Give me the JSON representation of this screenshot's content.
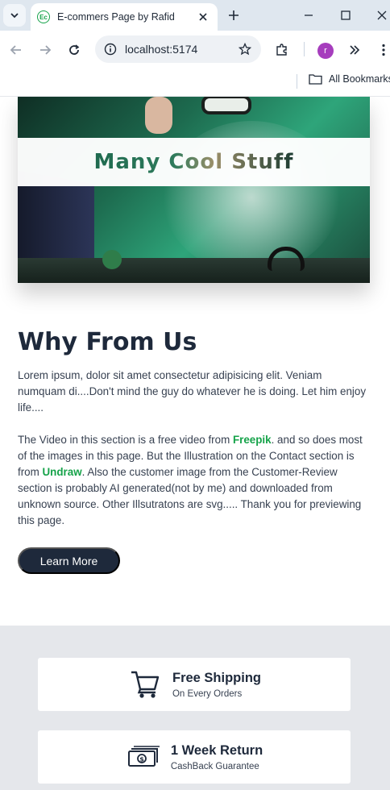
{
  "browser": {
    "tab_title": "E-commers Page by Rafid",
    "tab_favicon_text": "Ec",
    "url": "localhost:5174",
    "profile_initial": "r",
    "bookmarks_label": "All Bookmarks"
  },
  "hero": {
    "title": "Many Cool Stuff"
  },
  "why": {
    "title": "Why From Us",
    "paragraph1": "Lorem ipsum, dolor sit amet consectetur adipisicing elit. Veniam numquam di....Don't mind the guy do whatever he is doing. Let him enjoy life....",
    "p2_part1": "The Video in this section is a free video from ",
    "p2_link1": "Freepik",
    "p2_part2": ". and so does most of the images in this page. But the Illustration on the Contact section is from ",
    "p2_link2": "Undraw",
    "p2_part3": ". Also the customer image from the Customer-Review section is probably AI generated(not by me) and downloaded from unknown source. Other Illsutratons are svg..... Thank you for previewing this page.",
    "button_label": "Learn More"
  },
  "features": [
    {
      "title": "Free Shipping",
      "subtitle": "On Every Orders",
      "icon": "shopping-cart-icon"
    },
    {
      "title": "1 Week Return",
      "subtitle": "CashBack Guarantee",
      "icon": "cash-stack-icon"
    }
  ],
  "colors": {
    "accent_green": "#16a34a",
    "dark_button": "#1e293b",
    "feature_bg": "#e5e7eb"
  }
}
